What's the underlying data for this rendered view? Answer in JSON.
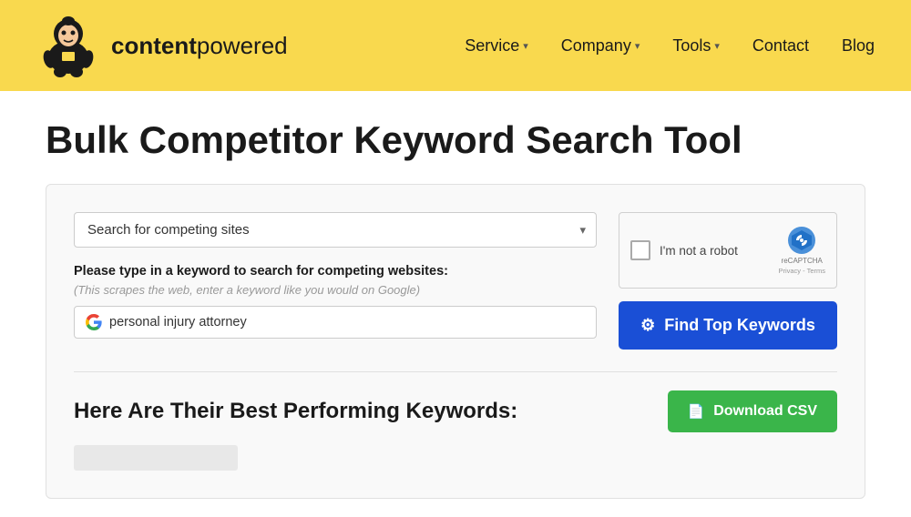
{
  "header": {
    "logo_bold": "content",
    "logo_regular": "powered",
    "nav_items": [
      {
        "label": "Service",
        "has_dropdown": true
      },
      {
        "label": "Company",
        "has_dropdown": true
      },
      {
        "label": "Tools",
        "has_dropdown": true
      },
      {
        "label": "Contact",
        "has_dropdown": false
      },
      {
        "label": "Blog",
        "has_dropdown": false
      }
    ]
  },
  "page": {
    "title": "Bulk Competitor Keyword Search Tool",
    "dropdown_placeholder": "Search for competing sites",
    "keyword_label": "Please type in a keyword to search for competing websites:",
    "keyword_hint": "(This scrapes the web, enter a keyword like you would on Google)",
    "keyword_input_value": "personal injury attorney",
    "recaptcha_text": "I'm not a robot",
    "recaptcha_brand": "reCAPTCHA",
    "recaptcha_privacy": "Privacy - Terms",
    "find_btn_label": "Find Top Keywords",
    "bottom_title": "Here Are Their Best Performing Keywords:",
    "download_btn_label": "Download CSV"
  }
}
